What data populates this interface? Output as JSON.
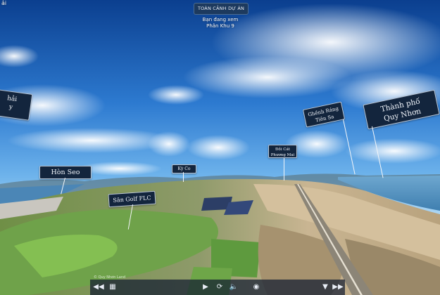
{
  "header": {
    "title": "TOÀN CẢNH DỰ ÁN",
    "viewing_label": "Bạn đang xem",
    "viewing_value": "Phân Khu 9"
  },
  "corner": {
    "text": "ải"
  },
  "hotspots": [
    {
      "label": "hải\ny"
    },
    {
      "label": "Hòn Seo"
    },
    {
      "label": "Sân Golf FLC"
    },
    {
      "label": "Kỳ Co"
    },
    {
      "label": "Đồi Cát\nPhương Mai"
    },
    {
      "label": "Ghềnh Ráng\nTiên Sa"
    },
    {
      "label": "Thành phố\nQuy Nhơn"
    }
  ],
  "toolbar": {
    "icons": [
      "rewind-icon",
      "grid-icon",
      "play-icon",
      "rotate-icon",
      "sound-icon",
      "map-pin-icon",
      "menu-icon",
      "fast-forward-icon"
    ]
  },
  "credit": "© Quy Nhơn Land"
}
